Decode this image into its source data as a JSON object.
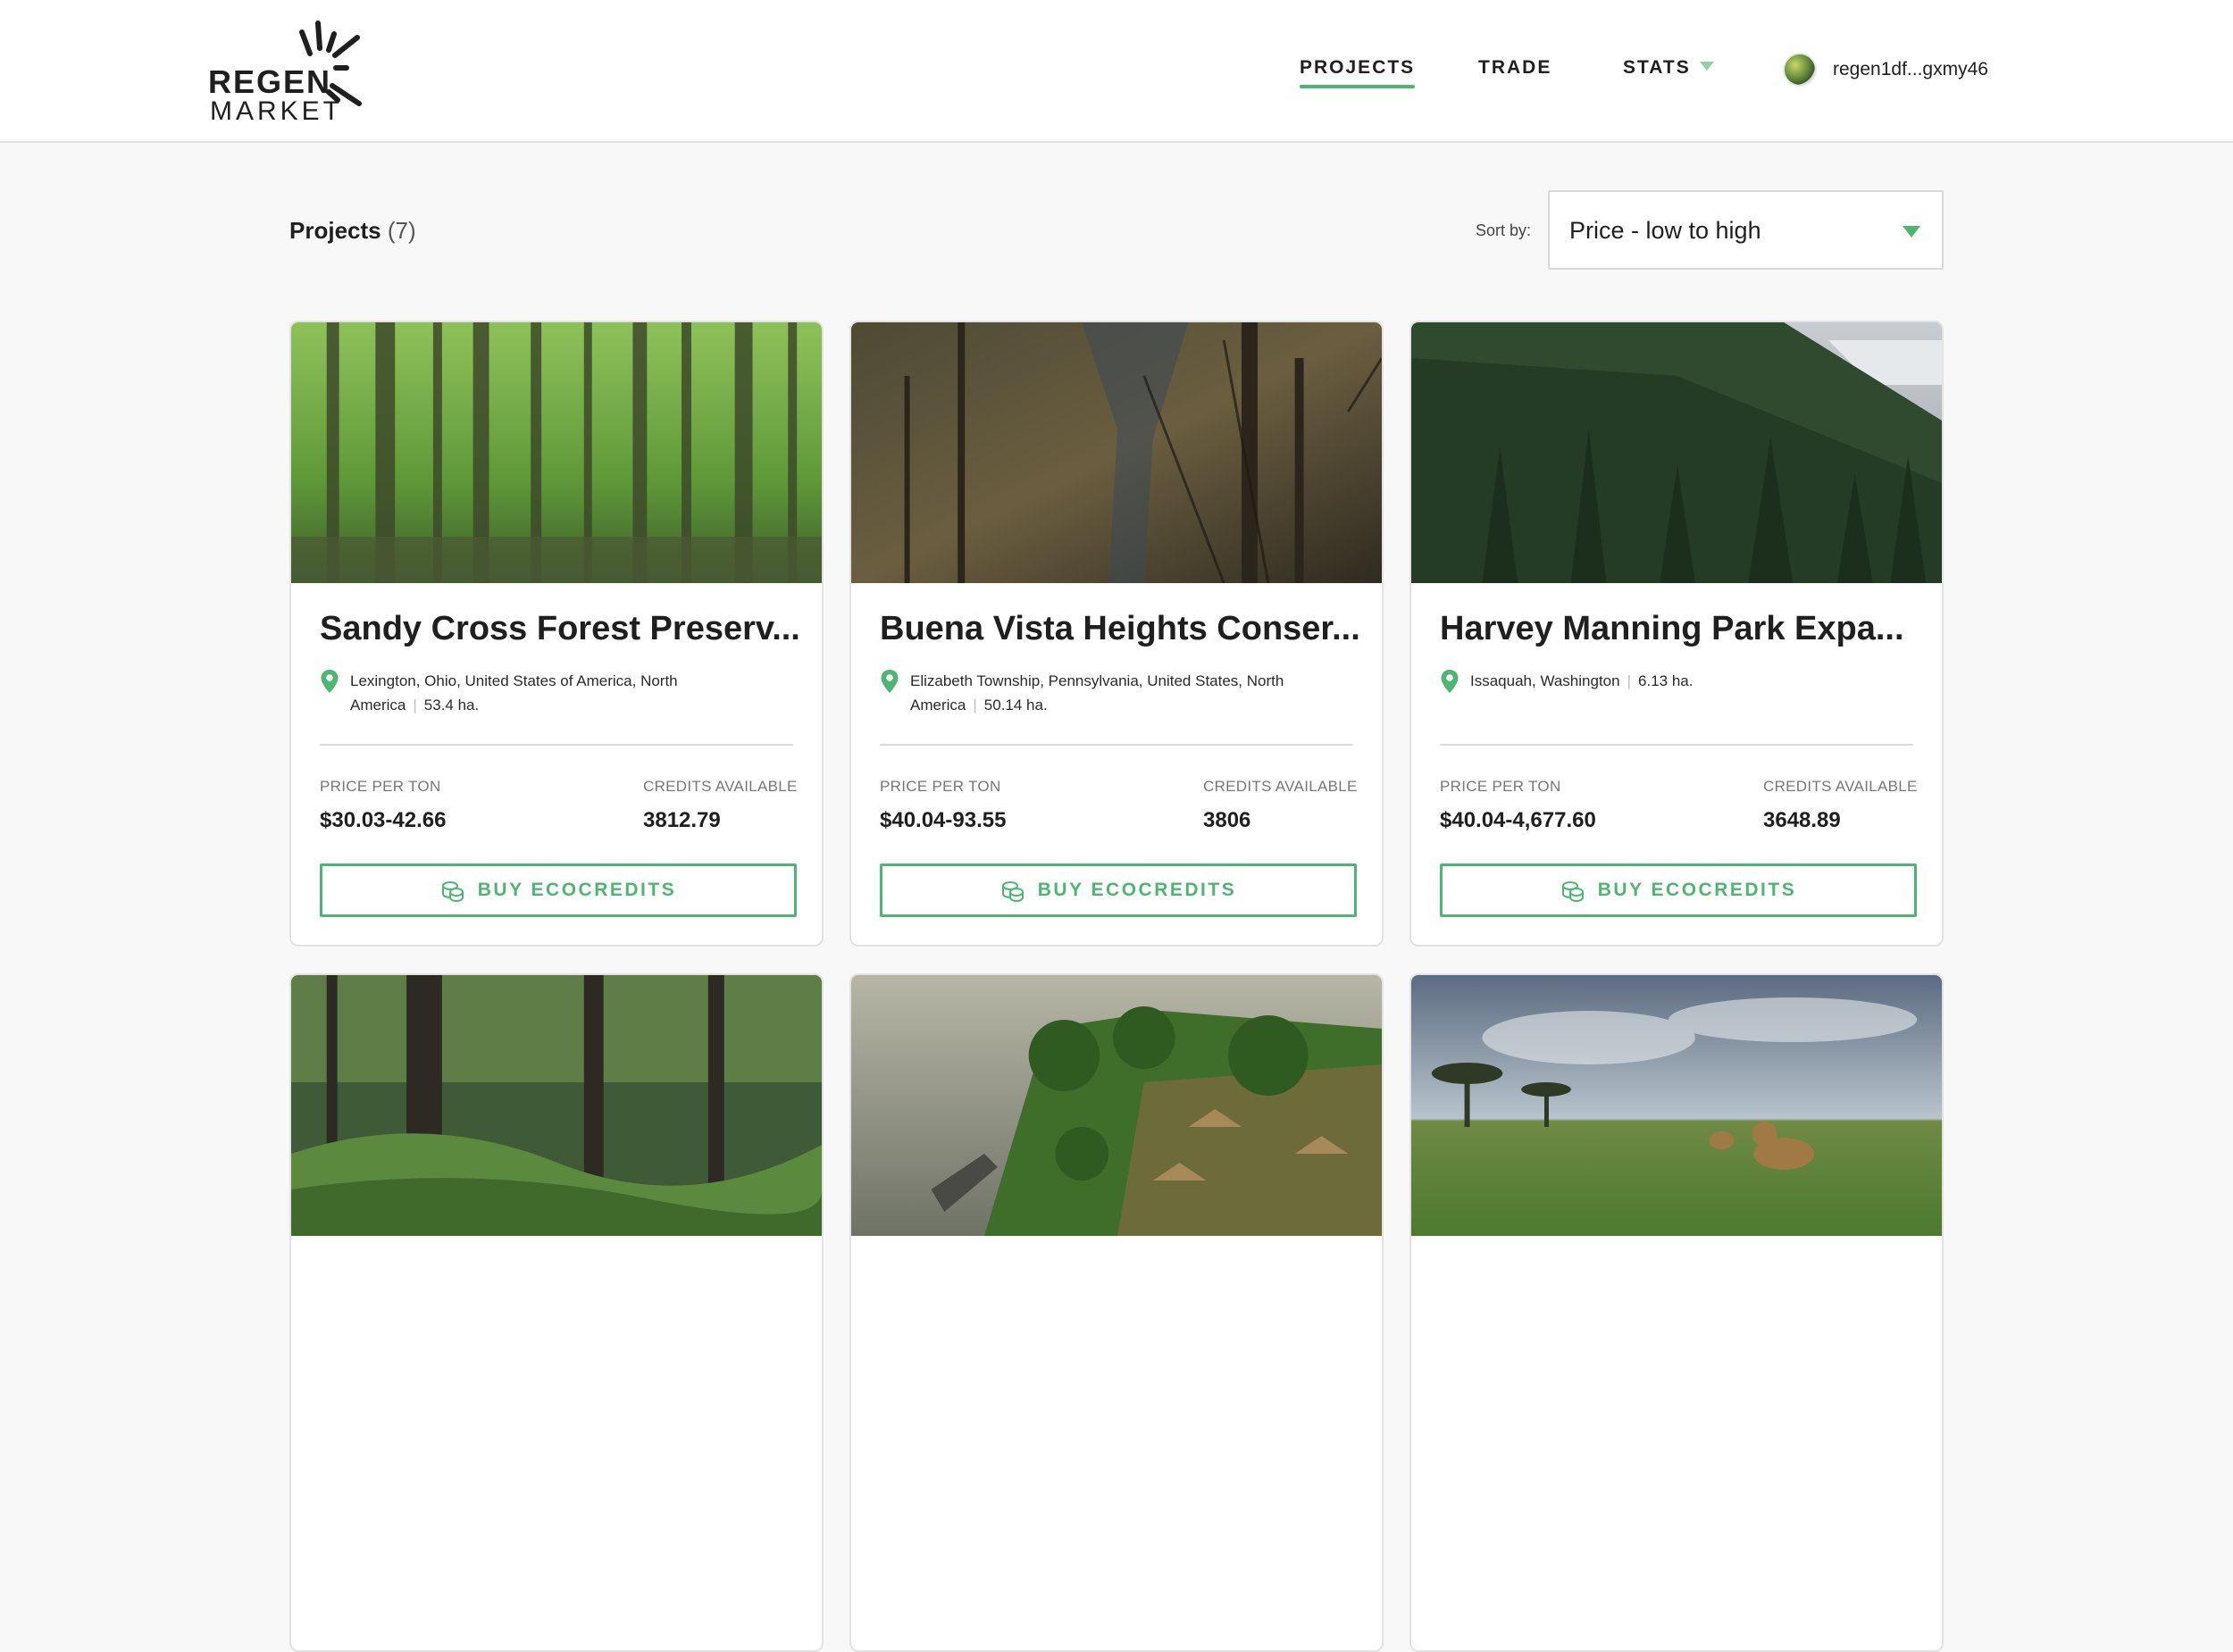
{
  "header": {
    "logo": {
      "top": "REGEN",
      "bottom": "MARKET"
    },
    "nav": {
      "projects": "PROJECTS",
      "trade": "TRADE",
      "stats": "STATS"
    },
    "account": "regen1df...gxmy46"
  },
  "toolbar": {
    "title": "Projects",
    "count": "(7)",
    "sort_label": "Sort by:",
    "sort_value": "Price - low to high"
  },
  "labels": {
    "price": "PRICE PER TON",
    "credits": "CREDITS AVAILABLE",
    "buy": "BUY ECOCREDITS"
  },
  "projects": [
    {
      "title": "Sandy Cross Forest Preserv...",
      "location": "Lexington, Ohio, United States of America, North America",
      "area": "53.4 ha.",
      "price": "$30.03-42.66",
      "credits": "3812.79"
    },
    {
      "title": "Buena Vista Heights Conser...",
      "location": "Elizabeth Township, Pennsylvania, United States, North America",
      "area": "50.14 ha.",
      "price": "$40.04-93.55",
      "credits": "3806"
    },
    {
      "title": "Harvey Manning Park Expa...",
      "location": "Issaquah, Washington",
      "area": "6.13 ha.",
      "price": "$40.04-4,677.60",
      "credits": "3648.89"
    },
    {},
    {},
    {}
  ],
  "colors": {
    "accent": "#4fb573",
    "accent_light": "#8fd1a6",
    "page_bg": "#f8f8f8",
    "text": "#1f1f1f"
  },
  "icons": {
    "logo": "regen-burst-logo-icon",
    "stats_caret": "chevron-down-icon",
    "sort_caret": "chevron-down-icon",
    "location": "location-pin-icon",
    "buy": "ecocredits-icon"
  }
}
